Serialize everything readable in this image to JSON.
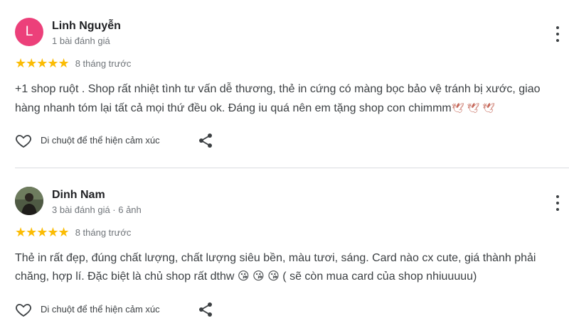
{
  "reviews": [
    {
      "avatar_letter": "L",
      "avatar_color": "#ec407a",
      "name": "Linh Nguyễn",
      "meta": "1 bài đánh giá",
      "stars": "★★★★★",
      "rating": 5,
      "time": "8 tháng trước",
      "text": "+1 shop ruột . Shop rất nhiệt tình tư vấn dễ thương, thẻ in cứng có màng bọc bảo vệ tránh bị xước, giao hàng nhanh tóm lại tất cả mọi thứ đều ok. Đáng iu quá nên em tặng shop con chimmm",
      "emojis": "🕊 🕊 🕊",
      "react_label": "Di chuột để thể hiện cảm xúc"
    },
    {
      "name": "Dinh Nam",
      "meta": "3 bài đánh giá · 6 ảnh",
      "stars": "★★★★★",
      "rating": 5,
      "time": "8 tháng trước",
      "text": "Thẻ in rất đẹp, đúng chất lượng, chất lượng siêu bền, màu tươi, sáng. Card nào cx cute, giá thành phải chăng, hợp lí. Đặc biệt là chủ shop rất dthw",
      "emojis": "😘 😘 😘",
      "text_tail": "( sẽ còn mua card của shop nhiuuuuu)",
      "react_label": "Di chuột để thể hiện cảm xúc"
    }
  ],
  "colors": {
    "star": "#fbbc04",
    "divider": "#dadce0",
    "muted": "#70757a"
  },
  "icons": [
    "heart-outline-icon",
    "share-icon",
    "more-vertical-icon"
  ]
}
